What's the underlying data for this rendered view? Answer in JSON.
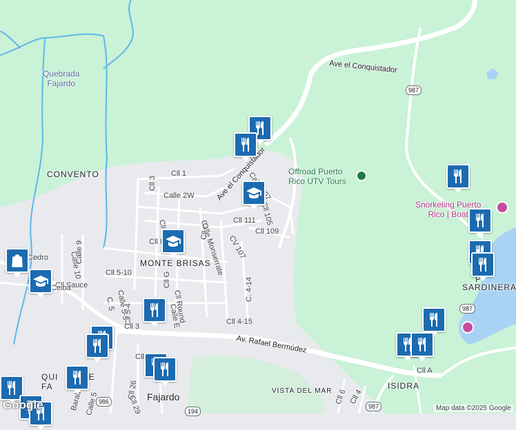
{
  "map": {
    "colors": {
      "forest": "#c9f2d6",
      "urban": "#e8eaed",
      "road": "#ffffff",
      "water": "#a8d3f5",
      "river": "#5fb6e8",
      "pin": "#1c6bb0"
    },
    "attribution": "Map data ©2025 Google",
    "logo": "Google",
    "labels": {
      "quebrada": "Quebrada\nFajardo",
      "convento": "CONVENTO",
      "monte_brisas": "MONTE BRISAS",
      "fajardo": "Fajardo",
      "quintas": "QUI        DE\nFA        DO",
      "vista_del_mar": "VISTA DEL MAR",
      "isidra": "ISIDRA",
      "sardinera_1": "P",
      "sardinera_2": "SARDINERA",
      "ave_conquistador_1": "Ave el Conquistador",
      "ave_conquistador_2": "Ave el Conquistador",
      "ave_rafael": "Av. Rafael Bermúdez",
      "offroad": "Offroad Puerto\nRico UTV Tours",
      "snorkeling": "Snorkeling Puerto\nRico | Boat",
      "shield_987_a": "987",
      "shield_987_b": "987",
      "shield_987_c": "987",
      "shield_986": "986",
      "shield_194": "194",
      "streets": [
        "Cll 1",
        "Cll 3",
        "Calle 2W",
        "Calle 107",
        "Cll 105",
        "Cll 111",
        "Cll 109",
        "CV 107",
        "Calle Monserrate",
        "Cll O",
        "Cll P",
        "Cll M",
        "Cll G",
        "Cll 5-10",
        "C. 4-14",
        "Cll 4-15",
        "Cll Round",
        "Calle E",
        "Calle 10",
        "Calle 9",
        "Cll Sauce",
        "Ceiba",
        "Cedro",
        "Calle 5-5",
        "C. 5",
        "Cll 5-4",
        "Cll 3",
        "Cll 26",
        "Cll 29",
        "Cll 6",
        "Cll 4",
        "Cll A",
        "Baralt",
        "Calle 5",
        "Cll"
      ]
    },
    "pins": [
      {
        "id": "restaurant-1",
        "icon": "fork-knife-icon"
      },
      {
        "id": "restaurant-2",
        "icon": "fork-knife-icon"
      },
      {
        "id": "school-1",
        "icon": "graduation-cap-icon"
      },
      {
        "id": "school-2",
        "icon": "graduation-cap-icon"
      },
      {
        "id": "school-3",
        "icon": "graduation-cap-icon"
      },
      {
        "id": "shopping-1",
        "icon": "shopping-bag-icon"
      },
      {
        "id": "restaurant-3",
        "icon": "fork-knife-icon"
      },
      {
        "id": "restaurant-4",
        "icon": "fork-knife-icon"
      },
      {
        "id": "restaurant-5",
        "icon": "fork-knife-icon"
      },
      {
        "id": "restaurant-6",
        "icon": "fork-knife-icon"
      },
      {
        "id": "restaurant-7",
        "icon": "fork-knife-icon"
      },
      {
        "id": "restaurant-8",
        "icon": "fork-knife-icon"
      },
      {
        "id": "restaurant-9",
        "icon": "fork-knife-icon"
      },
      {
        "id": "restaurant-10",
        "icon": "fork-knife-icon"
      },
      {
        "id": "restaurant-11",
        "icon": "fork-knife-icon"
      },
      {
        "id": "restaurant-12",
        "icon": "fork-knife-icon"
      },
      {
        "id": "restaurant-13",
        "icon": "fork-knife-icon"
      },
      {
        "id": "restaurant-14",
        "icon": "fork-knife-icon"
      },
      {
        "id": "restaurant-15",
        "icon": "fork-knife-icon"
      },
      {
        "id": "restaurant-16",
        "icon": "fork-knife-icon"
      },
      {
        "id": "restaurant-17",
        "icon": "fork-knife-icon"
      },
      {
        "id": "restaurant-18",
        "icon": "fork-knife-icon"
      }
    ]
  }
}
